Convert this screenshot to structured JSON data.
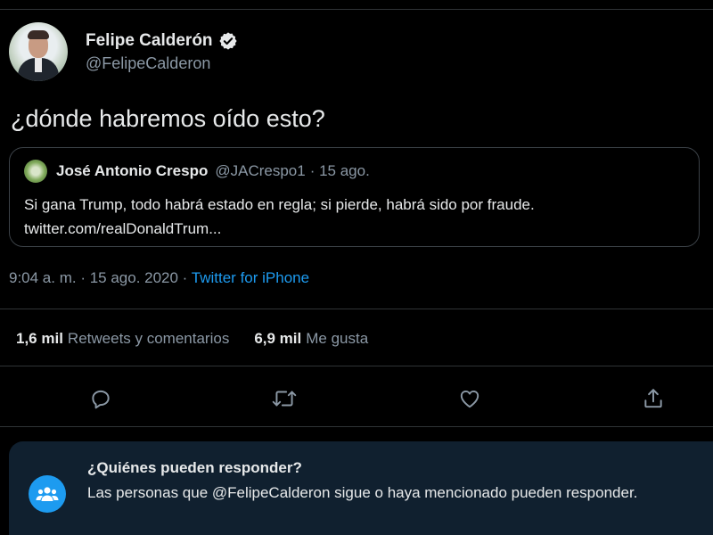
{
  "author": {
    "name": "Felipe Calderón",
    "handle": "@FelipeCalderon",
    "verified": true,
    "verified_icon": "verified-badge-icon"
  },
  "tweet": {
    "text": "¿dónde habremos oído esto?"
  },
  "quoted_tweet": {
    "name": "José Antonio Crespo",
    "handle": "@JACrespo1",
    "date": "· 15 ago.",
    "text": "Si gana Trump, todo habrá estado en regla; si pierde, habrá sido por fraude.",
    "link": "twitter.com/realDonaldTrum..."
  },
  "meta": {
    "time_date": "9:04 a. m. · 15 ago. 2020 ·",
    "source": "Twitter for iPhone"
  },
  "stats": {
    "retweets_count": "1,6 mil",
    "retweets_label": "Retweets y comentarios",
    "likes_count": "6,9 mil",
    "likes_label": "Me gusta"
  },
  "actions": [
    {
      "name": "reply-icon"
    },
    {
      "name": "retweet-icon"
    },
    {
      "name": "like-icon"
    },
    {
      "name": "share-icon"
    }
  ],
  "reply_notice": {
    "title": "¿Quiénes pueden responder?",
    "body": "Las personas que @FelipeCalderon sigue o haya mencionado pueden responder.",
    "icon": "people-icon"
  },
  "colors": {
    "background": "#000000",
    "text": "#e7e9ea",
    "secondary_text": "#8b98a5",
    "accent": "#1d9bf0",
    "notice_background": "#10202f"
  }
}
